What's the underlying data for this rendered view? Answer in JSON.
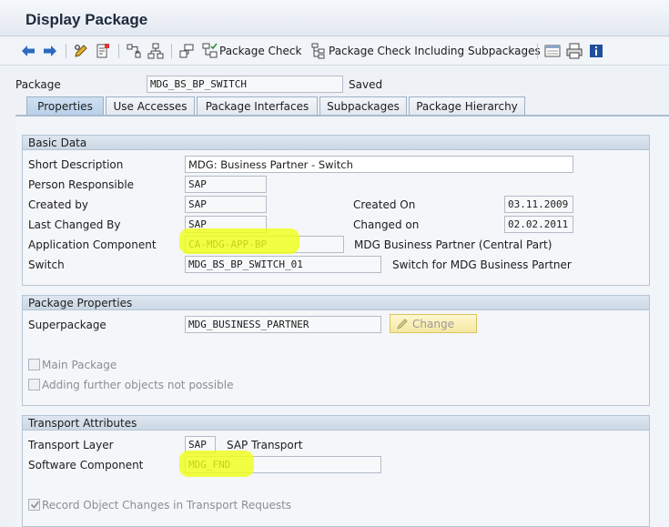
{
  "window": {
    "title": "Display Package"
  },
  "toolbar": {
    "package_check_label": "Package Check",
    "package_check_sub_label": "Package Check Including Subpackages"
  },
  "header": {
    "package_label": "Package",
    "package_value": "MDG_BS_BP_SWITCH",
    "status": "Saved"
  },
  "tabs": [
    {
      "label": "Properties"
    },
    {
      "label": "Use Accesses"
    },
    {
      "label": "Package Interfaces"
    },
    {
      "label": "Subpackages"
    },
    {
      "label": "Package Hierarchy"
    }
  ],
  "basic_data": {
    "title": "Basic Data",
    "short_description_label": "Short Description",
    "short_description": "MDG: Business Partner - Switch",
    "person_responsible_label": "Person Responsible",
    "person_responsible": "SAP",
    "created_by_label": "Created by",
    "created_by": "SAP",
    "created_on_label": "Created On",
    "created_on": "03.11.2009",
    "last_changed_by_label": "Last Changed By",
    "last_changed_by": "SAP",
    "changed_on_label": "Changed on",
    "changed_on": "02.02.2011",
    "application_component_label": "Application Component",
    "application_component": "CA-MDG-APP-BP",
    "application_component_text": "MDG Business Partner (Central Part)",
    "switch_label": "Switch",
    "switch": "MDG_BS_BP_SWITCH_01",
    "switch_text": "Switch for MDG Business Partner"
  },
  "package_properties": {
    "title": "Package Properties",
    "superpackage_label": "Superpackage",
    "superpackage": "MDG_BUSINESS_PARTNER",
    "change_button": "Change",
    "main_package_label": "Main Package",
    "main_package_checked": false,
    "adding_label": "Adding further objects not possible",
    "adding_checked": false
  },
  "transport": {
    "title": "Transport Attributes",
    "transport_layer_label": "Transport Layer",
    "transport_layer": "SAP",
    "transport_layer_text": "SAP Transport",
    "software_component_label": "Software Component",
    "software_component": "MDG_FND",
    "record_label": "Record Object Changes in Transport Requests",
    "record_checked": true
  },
  "colors": {
    "highlight": "#f0ff14",
    "tab_active": "#c4d7ed",
    "accent": "#1f5fb0"
  }
}
